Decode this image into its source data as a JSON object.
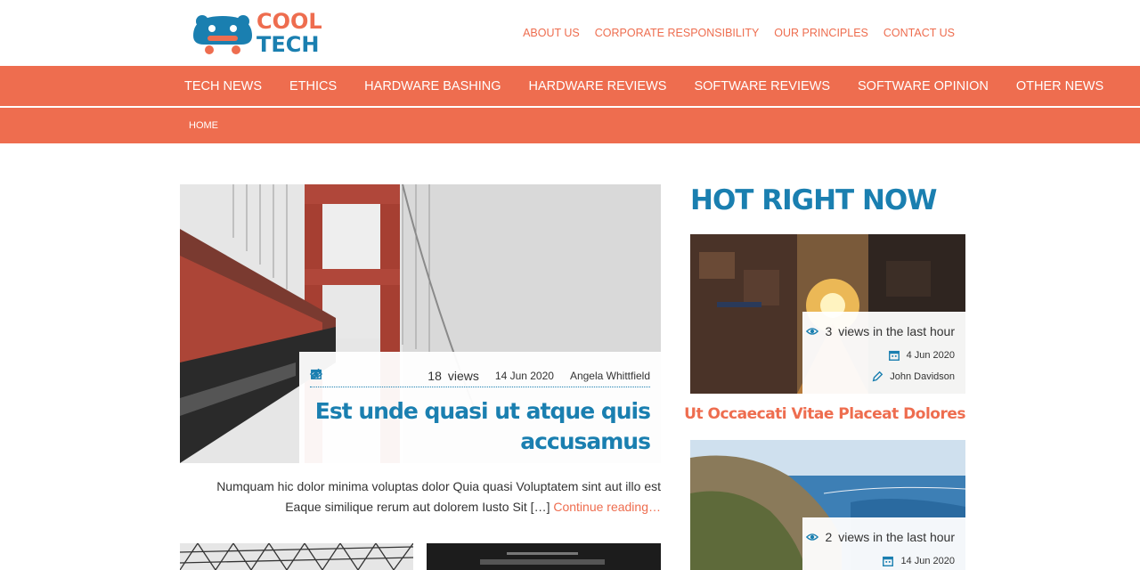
{
  "brand": {
    "line1": "COOL",
    "line2": "TECH"
  },
  "top_links": [
    "ABOUT US",
    "CORPORATE RESPONSIBILITY",
    "OUR PRINCIPLES",
    "CONTACT US"
  ],
  "main_nav": [
    "TECH NEWS",
    "ETHICS",
    "HARDWARE BASHING",
    "HARDWARE REVIEWS",
    "SOFTWARE REVIEWS",
    "SOFTWARE OPINION",
    "OTHER NEWS"
  ],
  "breadcrumb": "HOME",
  "feature": {
    "views_count": "18",
    "views_label": "views",
    "date": "14 Jun 2020",
    "author": "Angela Whittfield",
    "title": "Est unde quasi ut atque quis accusamus",
    "excerpt": "Numquam hic dolor minima voluptas dolor Quia quasi Voluptatem sint aut illo est Eaque similique rerum aut dolorem Iusto Sit […]",
    "read_more": "Continue reading…"
  },
  "sidebar": {
    "heading": "HOT RIGHT NOW",
    "posts": [
      {
        "views_count": "3",
        "views_label": "views in the last hour",
        "date": "4 Jun 2020",
        "author": "John Davidson",
        "title": "Ut Occaecati Vitae Placeat Dolores"
      },
      {
        "views_count": "2",
        "views_label": "views in the last hour",
        "date": "14 Jun 2020"
      }
    ]
  },
  "colors": {
    "accent": "#ee6d4f",
    "brand_blue": "#1a7fb0"
  },
  "icons": {
    "views": "eye-icon",
    "date": "calendar-icon",
    "author": "pencil-icon"
  }
}
